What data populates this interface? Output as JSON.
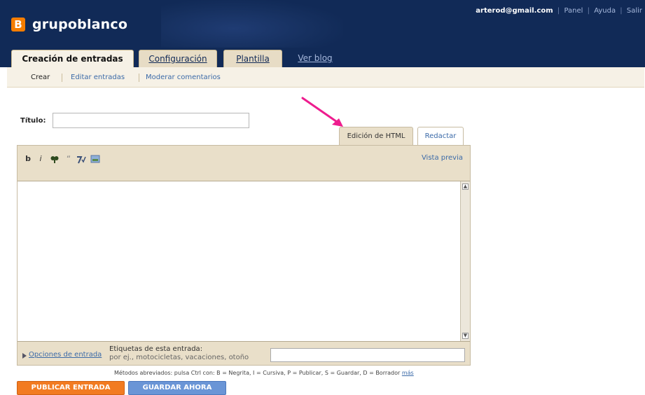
{
  "header": {
    "blog_name": "grupoblanco",
    "user_email": "arterod@gmail.com",
    "links": [
      "Panel",
      "Ayuda",
      "Salir"
    ],
    "brand_color": "#112a57",
    "logo_color": "#f57d00"
  },
  "tabs": [
    {
      "label": "Creación de entradas",
      "active": true
    },
    {
      "label": "Configuración",
      "active": false
    },
    {
      "label": "Plantilla",
      "active": false
    },
    {
      "label": "Ver blog",
      "active": false
    }
  ],
  "subnav": [
    "Crear",
    "Editar entradas",
    "Moderar comentarios"
  ],
  "editor": {
    "title_label": "Título:",
    "title_value": "",
    "mode_tabs": [
      "Edición de HTML",
      "Redactar"
    ],
    "preview_label": "Vista previa",
    "toolbar_icons": [
      "bold-icon",
      "italic-icon",
      "link-icon",
      "quote-icon",
      "spellcheck-icon",
      "image-icon"
    ],
    "body_value": ""
  },
  "options": {
    "link_label": "Opciones de entrada",
    "labels_title": "Etiquetas de esta entrada:",
    "labels_example": "por ej., motocicletas, vacaciones, otoño",
    "labels_value": ""
  },
  "shortcuts": {
    "text": "Métodos abreviados: pulsa Ctrl con: B = Negrita, I = Cursiva, P = Publicar, S = Guardar, D = Borrador",
    "more_link": "más"
  },
  "actions": {
    "publish_label": "PUBLICAR ENTRADA",
    "save_label": "GUARDAR AHORA",
    "publish_color": "#f27b21",
    "save_color": "#6a95d6"
  },
  "annotation": {
    "arrow_color": "#ee1c8e"
  }
}
